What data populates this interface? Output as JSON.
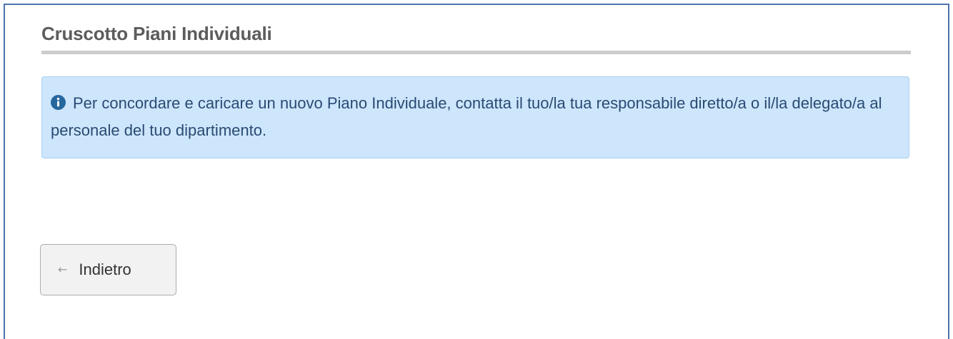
{
  "page": {
    "title": "Cruscotto Piani Individuali"
  },
  "alert": {
    "icon": "info-circle-icon",
    "message": "Per concordare e caricare un nuovo Piano Individuale, contatta il tuo/la tua responsabile diretto/a o il/la delegato/a al personale del tuo dipartimento.",
    "background_color": "#cde6fc",
    "icon_color": "#26679e"
  },
  "back_button": {
    "icon": "arrow-left-icon",
    "label": "Indietro"
  },
  "colors": {
    "frame_border": "#4a74ae",
    "title_text": "#5c5c5c",
    "title_rule": "#cccccc"
  }
}
